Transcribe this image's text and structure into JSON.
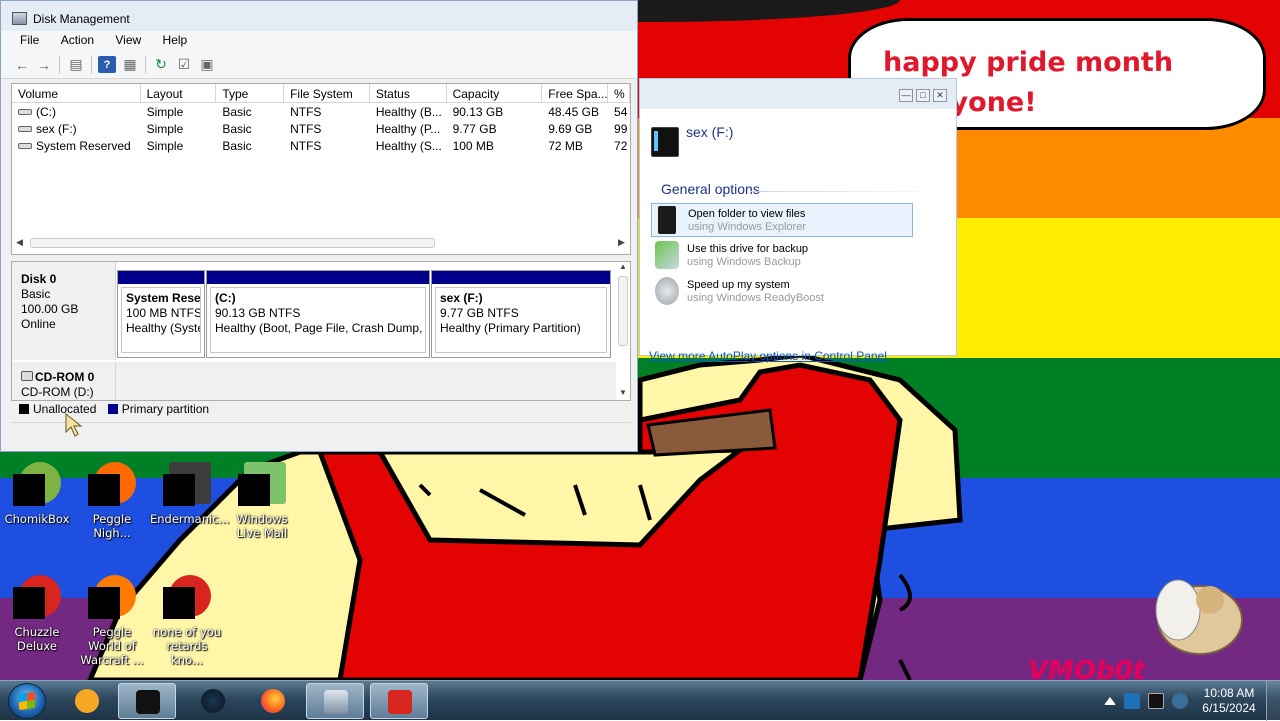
{
  "wallpaper": {
    "speech_bubble_text": "happy pride month everyone!",
    "watermark_text": "VMOb0t",
    "stripe_colors": [
      "#e40303",
      "#ff8c00",
      "#ffed00",
      "#008026",
      "#1f4fe0",
      "#732982"
    ]
  },
  "desktop_icons": [
    {
      "label": "ChomikBox",
      "icon": "hamster-icon",
      "color": "#7db343"
    },
    {
      "label": "Peggle Nigh...",
      "icon": "peggle-icon",
      "color": "#ff6a00"
    },
    {
      "label": "Endermanic...",
      "icon": "app-window-icon",
      "color": "#3d3d3d"
    },
    {
      "label": "Windows Live Mail",
      "icon": "mail-icon",
      "color": "#7cc36b"
    },
    {
      "label": "Chuzzle Deluxe",
      "icon": "chuzzle-icon",
      "color": "#d8261e"
    },
    {
      "label": "Peggle World of Warcraft ...",
      "icon": "peggle-icon",
      "color": "#ff7a00"
    },
    {
      "label": "none of you retards kno...",
      "icon": "app-icon",
      "color": "#d8261e"
    }
  ],
  "disk_management": {
    "title": "Disk Management",
    "menu": [
      "File",
      "Action",
      "View",
      "Help"
    ],
    "toolbar_icons": [
      "back-icon",
      "forward-icon",
      "console-tree-icon",
      "help-icon",
      "properties-icon",
      "refresh-icon",
      "export-icon",
      "settings-icon"
    ],
    "columns": [
      "Volume",
      "Layout",
      "Type",
      "File System",
      "Status",
      "Capacity",
      "Free Spa...",
      "%"
    ],
    "volumes": [
      {
        "volume": "(C:)",
        "layout": "Simple",
        "type": "Basic",
        "fs": "NTFS",
        "status": "Healthy (B...",
        "capacity": "90.13 GB",
        "free": "48.45 GB",
        "pct": "54"
      },
      {
        "volume": "sex (F:)",
        "layout": "Simple",
        "type": "Basic",
        "fs": "NTFS",
        "status": "Healthy (P...",
        "capacity": "9.77 GB",
        "free": "9.69 GB",
        "pct": "99"
      },
      {
        "volume": "System Reserved",
        "layout": "Simple",
        "type": "Basic",
        "fs": "NTFS",
        "status": "Healthy (S...",
        "capacity": "100 MB",
        "free": "72 MB",
        "pct": "72"
      }
    ],
    "disk0": {
      "name": "Disk 0",
      "type": "Basic",
      "size": "100.00 GB",
      "state": "Online",
      "partitions": [
        {
          "name": "System Reser",
          "size": "100 MB NTFS",
          "status": "Healthy (Syste"
        },
        {
          "name": "(C:)",
          "size": "90.13 GB NTFS",
          "status": "Healthy (Boot, Page File, Crash Dump, F"
        },
        {
          "name": "sex  (F:)",
          "size": "9.77 GB NTFS",
          "status": "Healthy (Primary Partition)"
        }
      ]
    },
    "cdrom": {
      "name": "CD-ROM 0",
      "drive": "CD-ROM (D:)"
    },
    "legend": [
      {
        "label": "Unallocated",
        "color": "#000000"
      },
      {
        "label": "Primary partition",
        "color": "#00008b"
      }
    ]
  },
  "autoplay": {
    "drive_name": "sex (F:)",
    "section_title": "General options",
    "options": [
      {
        "main": "Open folder to view files",
        "sub": "using Windows Explorer",
        "icon": "folder-icon"
      },
      {
        "main": "Use this drive for backup",
        "sub": "using Windows Backup",
        "icon": "backup-icon"
      },
      {
        "main": "Speed up my system",
        "sub": "using Windows ReadyBoost",
        "icon": "readyboost-icon"
      }
    ],
    "link": "View more AutoPlay options in Control Panel"
  },
  "taskbar": {
    "pinned": [
      "media-player-icon",
      "disk-management-icon",
      "windows-explorer-icon",
      "firefox-icon",
      "network-icon",
      "toolbox-icon"
    ],
    "clock_time": "10:08 AM",
    "clock_date": "6/15/2024"
  }
}
